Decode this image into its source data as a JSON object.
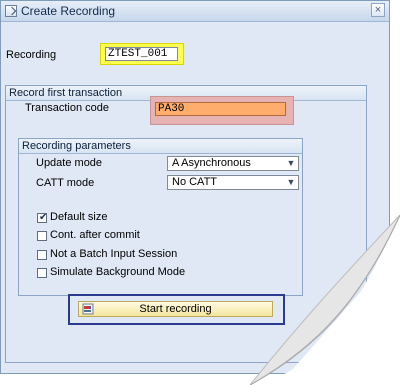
{
  "window": {
    "title": "Create Recording",
    "close_glyph": "×"
  },
  "form": {
    "recording_label": "Recording",
    "recording_value": "ZTEST_001"
  },
  "first_transaction": {
    "title": "Record first transaction",
    "transaction_code_label": "Transaction code",
    "transaction_code_value": "PA30"
  },
  "parameters": {
    "title": "Recording parameters",
    "update_mode_label": "Update mode",
    "update_mode_value": "A Asynchronous",
    "catt_mode_label": "CATT mode",
    "catt_mode_value": "No CATT",
    "dropdown_arrow": "▼"
  },
  "options": [
    {
      "label": "Default size",
      "checked": true
    },
    {
      "label": "Cont. after commit",
      "checked": false
    },
    {
      "label": "Not a Batch Input Session",
      "checked": false
    },
    {
      "label": "Simulate Background Mode",
      "checked": false
    }
  ],
  "checkmark": "✔",
  "actions": {
    "start_recording_label": "Start recording"
  },
  "colors": {
    "highlight_yellow": "#ffff4d",
    "highlight_red": "#e7b2b2",
    "tcode_orange": "#ffad6c",
    "button_border_blue": "#2a3a8f"
  }
}
